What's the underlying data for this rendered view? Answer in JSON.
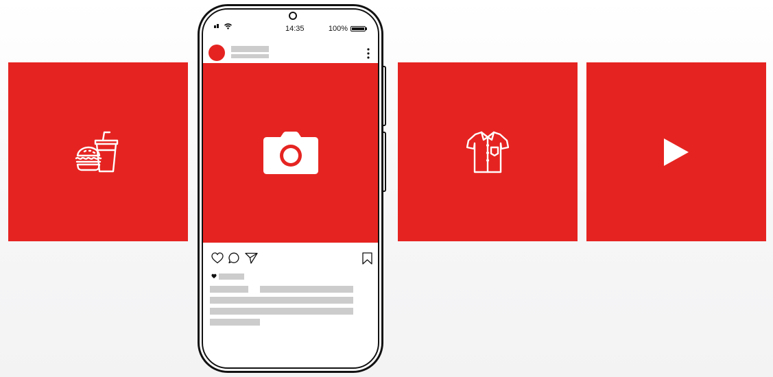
{
  "tiles": [
    {
      "icon": "food-drink-icon"
    },
    {
      "icon": "shirt-icon"
    },
    {
      "icon": "play-icon"
    }
  ],
  "phone": {
    "status_bar": {
      "time": "14:35",
      "battery": "100%"
    },
    "post": {
      "image_icon": "camera-icon",
      "actions": [
        "heart-icon",
        "comment-icon",
        "send-icon",
        "bookmark-icon"
      ],
      "likes_icon": "heart-small-icon"
    }
  },
  "colors": {
    "accent": "#e52421",
    "placeholder": "#cccccc",
    "outline": "#111111"
  }
}
